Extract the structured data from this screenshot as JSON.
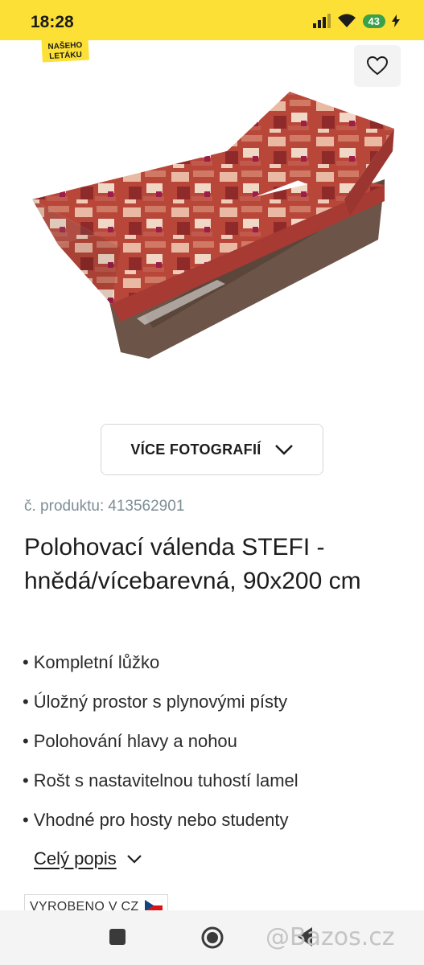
{
  "status_bar": {
    "time": "18:28",
    "battery": "43",
    "icons": [
      "signal-icon",
      "wifi-icon",
      "battery-icon",
      "charging-icon"
    ]
  },
  "image": {
    "promo_badge": "NAŠEHO\nLETÁKU",
    "favorite_icon": "heart-outline-icon"
  },
  "more_photos": {
    "label": "VÍCE FOTOGRAFIÍ",
    "icon": "chevron-down-icon"
  },
  "product": {
    "number_label": "č. produktu:",
    "number": "413562901",
    "title": "Polohovací válenda STEFI - hnědá/vícebarevná, 90x200 cm",
    "features": [
      "Kompletní lůžko",
      "Úložný prostor s plynovými písty",
      "Polohování hlavy a nohou",
      "Rošt s nastavitelnou tuhostí lamel",
      "Vhodné pro hosty nebo studenty"
    ],
    "description_link": "Celý popis",
    "made_in": "VYROBENO V CZ"
  },
  "nav": {
    "items": [
      "recents-square",
      "home-circle",
      "back-triangle"
    ]
  },
  "watermark": "@Bazos.cz",
  "colors": {
    "brand_yellow": "#fde036",
    "text": "#1c1c1c",
    "muted": "#7d8e96"
  }
}
